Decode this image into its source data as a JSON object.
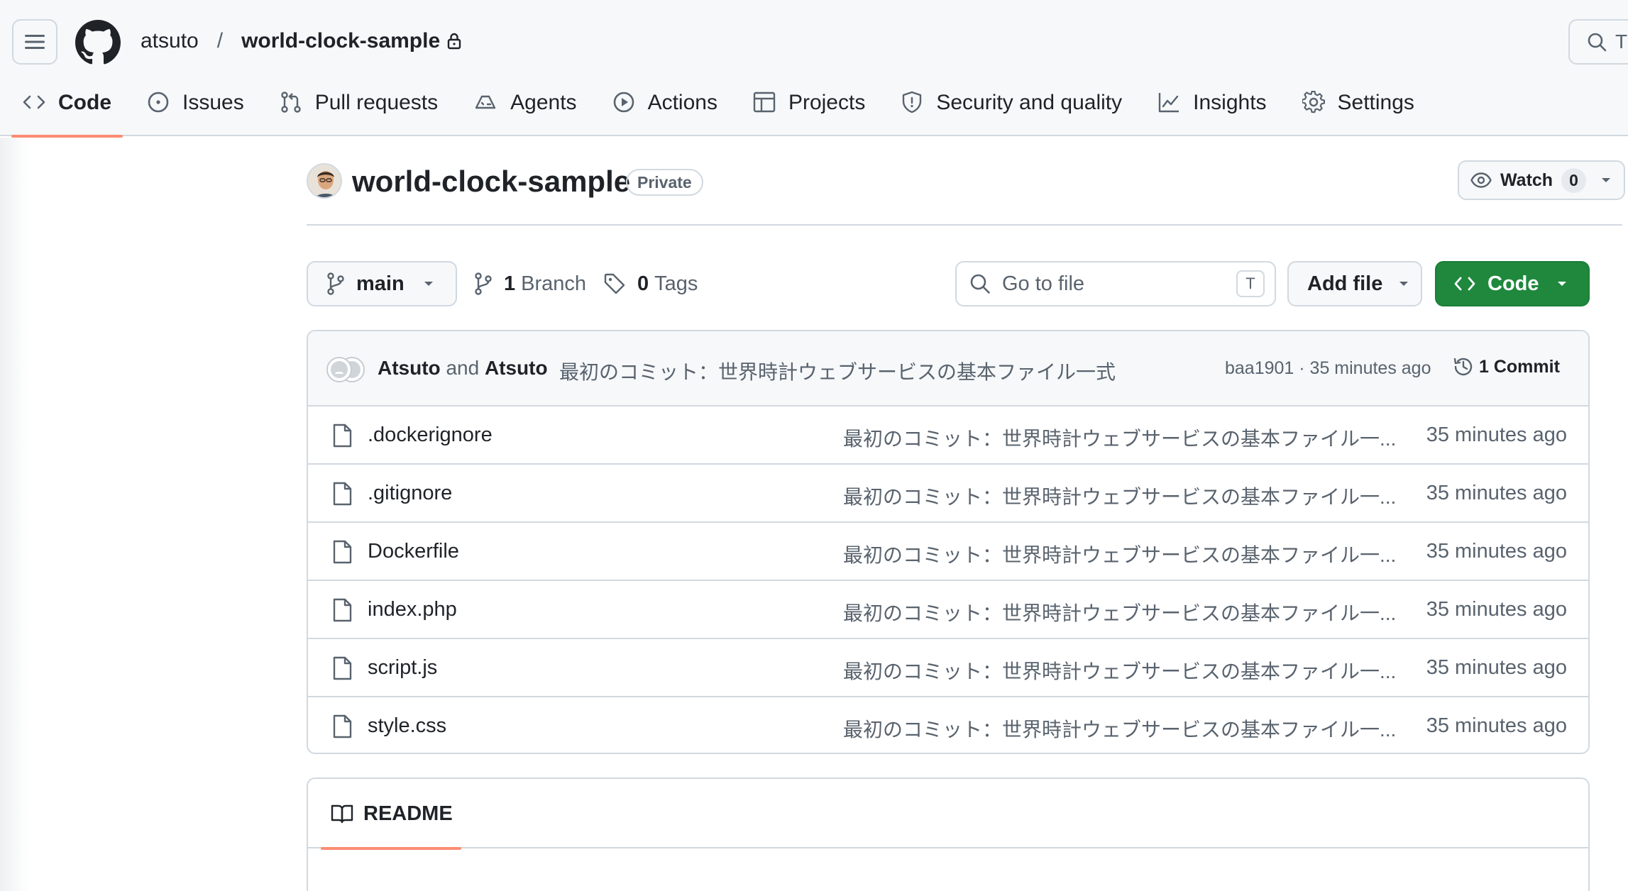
{
  "header": {
    "owner": "atsuto",
    "separator": "/",
    "repo": "world-clock-sample",
    "search_placeholder": "T"
  },
  "tabs": [
    {
      "label": "Code",
      "icon": "code-icon",
      "active": true
    },
    {
      "label": "Issues",
      "icon": "issue-opened-icon"
    },
    {
      "label": "Pull requests",
      "icon": "git-pull-request-icon"
    },
    {
      "label": "Agents",
      "icon": "agent-icon"
    },
    {
      "label": "Actions",
      "icon": "play-icon"
    },
    {
      "label": "Projects",
      "icon": "table-icon"
    },
    {
      "label": "Security and quality",
      "icon": "shield-icon"
    },
    {
      "label": "Insights",
      "icon": "graph-icon"
    },
    {
      "label": "Settings",
      "icon": "gear-icon"
    }
  ],
  "repo": {
    "title": "world-clock-sample",
    "visibility": "Private",
    "watch_label": "Watch",
    "watch_count": "0"
  },
  "toolbar": {
    "branch": "main",
    "branch_count": "1",
    "branch_label": "Branch",
    "tag_count": "0",
    "tag_label": "Tags",
    "goto_placeholder": "Go to file",
    "goto_shortcut": "T",
    "add_file": "Add file",
    "code": "Code"
  },
  "commit": {
    "author1": "Atsuto",
    "and": "and",
    "author2": "Atsuto",
    "message": "最初のコミット：世界時計ウェブサービスの基本ファイル一式",
    "meta": "baa1901 · 35 minutes ago",
    "count": "1 Commit"
  },
  "files": [
    {
      "name": ".dockerignore",
      "message": "最初のコミット：世界時計ウェブサービスの基本ファイル一...",
      "time": "35 minutes ago"
    },
    {
      "name": ".gitignore",
      "message": "最初のコミット：世界時計ウェブサービスの基本ファイル一...",
      "time": "35 minutes ago"
    },
    {
      "name": "Dockerfile",
      "message": "最初のコミット：世界時計ウェブサービスの基本ファイル一...",
      "time": "35 minutes ago"
    },
    {
      "name": "index.php",
      "message": "最初のコミット：世界時計ウェブサービスの基本ファイル一...",
      "time": "35 minutes ago"
    },
    {
      "name": "script.js",
      "message": "最初のコミット：世界時計ウェブサービスの基本ファイル一...",
      "time": "35 minutes ago"
    },
    {
      "name": "style.css",
      "message": "最初のコミット：世界時計ウェブサービスの基本ファイル一...",
      "time": "35 minutes ago"
    }
  ],
  "readme": {
    "tab_label": "README"
  },
  "colors": {
    "accent_underline": "#fd8c73",
    "primary_button": "#1f883d",
    "border": "#d1d9e0",
    "muted_text": "#59636e"
  }
}
